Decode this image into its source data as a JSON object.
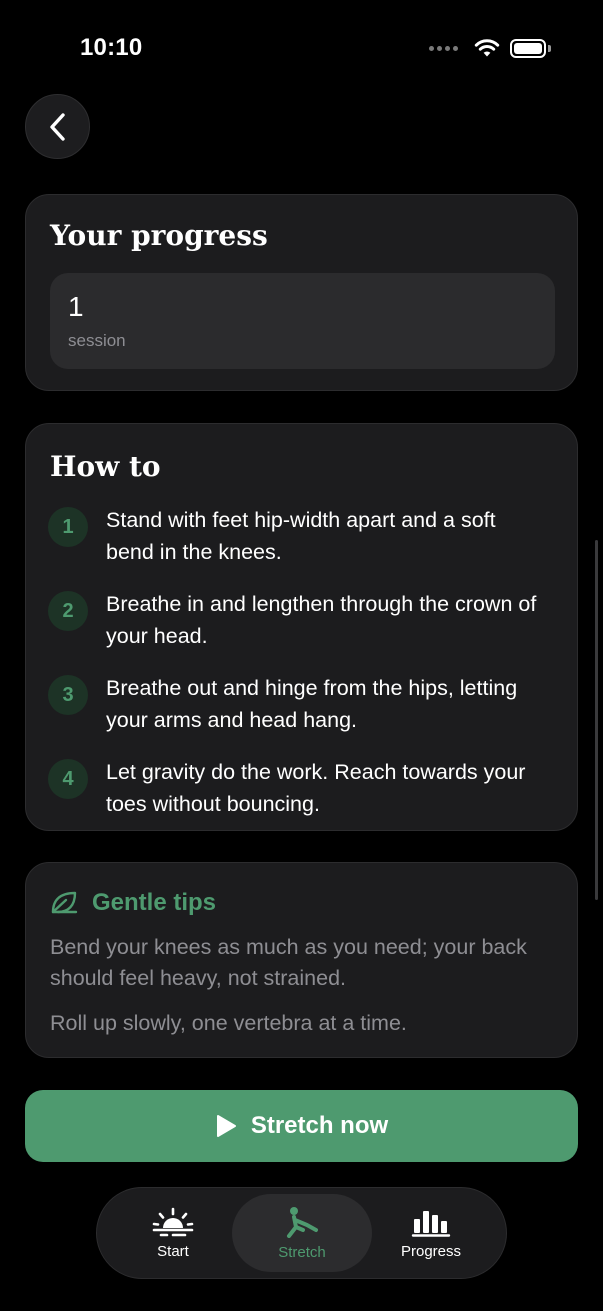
{
  "status_bar": {
    "time": "10:10"
  },
  "progress_card": {
    "title": "Your progress",
    "stat_value": "1",
    "stat_label": "session"
  },
  "howto": {
    "title": "How to",
    "steps": [
      {
        "num": "1",
        "text": "Stand with feet hip-width apart and a soft bend in the knees."
      },
      {
        "num": "2",
        "text": "Breathe in and lengthen through the crown of your head."
      },
      {
        "num": "3",
        "text": "Breathe out and hinge from the hips, letting your arms and head hang."
      },
      {
        "num": "4",
        "text": "Let gravity do the work. Reach towards your toes without bouncing."
      }
    ]
  },
  "tips": {
    "title": "Gentle tips",
    "items": [
      "Bend your knees as much as you need; your back should feel heavy, not strained.",
      "Roll up slowly, one vertebra at a time."
    ]
  },
  "primary_button": {
    "label": "Stretch now"
  },
  "tab_bar": {
    "tabs": [
      {
        "label": "Start",
        "icon": "sunrise-icon",
        "active": false
      },
      {
        "label": "Stretch",
        "icon": "stretch-figure-icon",
        "active": true
      },
      {
        "label": "Progress",
        "icon": "bar-chart-icon",
        "active": false
      }
    ]
  },
  "colors": {
    "background": "#000000",
    "card": "#1c1c1e",
    "accent": "#4e9a6f",
    "secondary_text": "#8e8e93"
  }
}
